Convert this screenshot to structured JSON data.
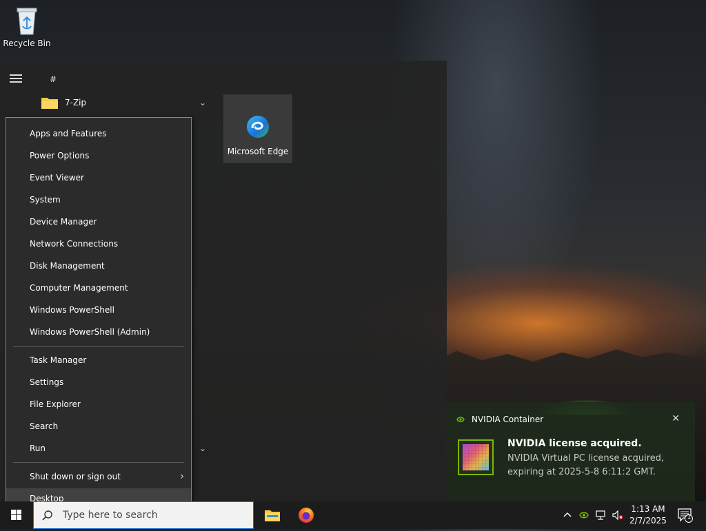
{
  "desktop": {
    "icons": [
      {
        "label": "Recycle Bin",
        "icon": "recycle-bin-icon"
      }
    ]
  },
  "start_menu": {
    "letter_header": "#",
    "apps": [
      {
        "label": "7-Zip",
        "icon": "folder-icon"
      }
    ],
    "tiles": [
      {
        "label": "Microsoft Edge",
        "icon": "edge-icon"
      }
    ]
  },
  "context_menu": {
    "group1": [
      "Apps and Features",
      "Power Options",
      "Event Viewer",
      "System",
      "Device Manager",
      "Network Connections",
      "Disk Management",
      "Computer Management",
      "Windows PowerShell",
      "Windows PowerShell (Admin)"
    ],
    "group2": [
      "Task Manager",
      "Settings",
      "File Explorer",
      "Search",
      "Run"
    ],
    "group3": [
      "Shut down or sign out",
      "Desktop"
    ],
    "highlighted": "Desktop"
  },
  "notification": {
    "app_name": "NVIDIA Container",
    "title": "NVIDIA license acquired.",
    "body": "NVIDIA Virtual PC license acquired, expiring at 2025-5-8 6:11:2 GMT.",
    "accent": "#76b900"
  },
  "taskbar": {
    "search_placeholder": "Type here to search",
    "pinned": [
      "file-explorer-icon",
      "firefox-icon"
    ],
    "clock_time": "1:13 AM",
    "clock_date": "2/7/2025",
    "notification_count": "1"
  }
}
